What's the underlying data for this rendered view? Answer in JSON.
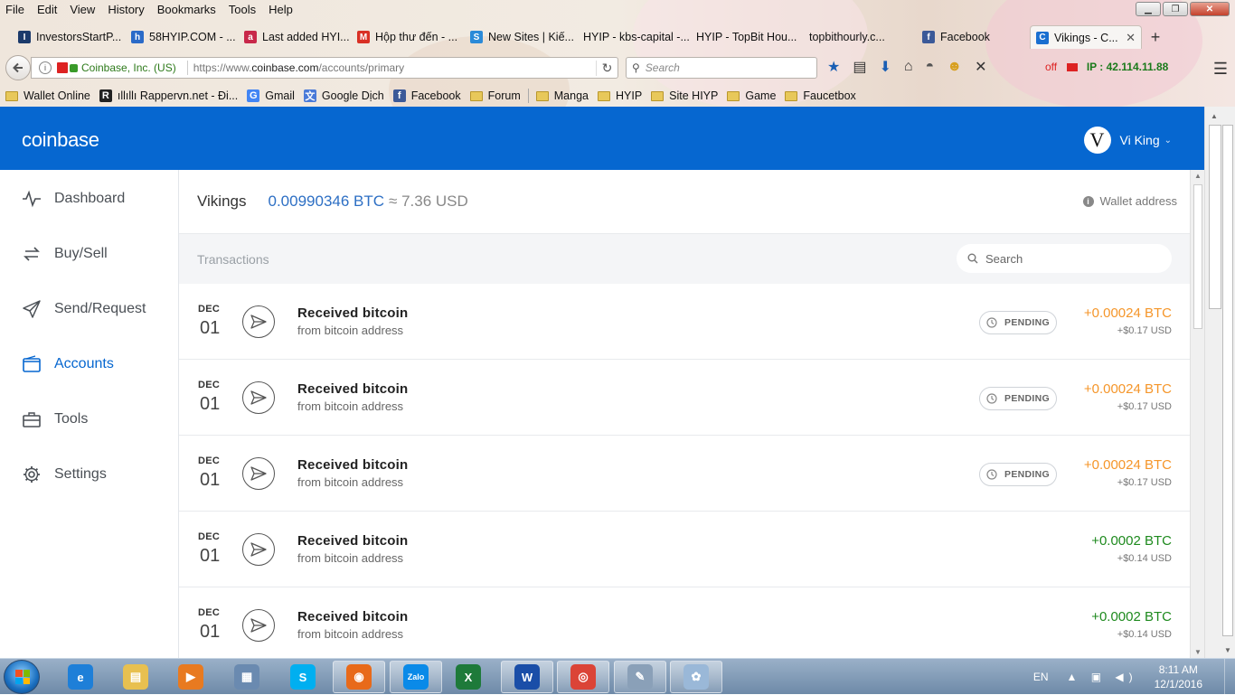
{
  "browser": {
    "menu": [
      "File",
      "Edit",
      "View",
      "History",
      "Bookmarks",
      "Tools",
      "Help"
    ],
    "tabs": [
      {
        "label": "InvestorsStartP...",
        "icon": "investorsstart-favicon",
        "color": "#1b3a6b",
        "glyph": "I"
      },
      {
        "label": "58HYIP.COM - ...",
        "icon": "hyip58-favicon",
        "color": "#2a6ac8",
        "glyph": "h"
      },
      {
        "label": "Last added HYI...",
        "icon": "lastadded-favicon",
        "color": "#c8284a",
        "glyph": "a"
      },
      {
        "label": "Hộp thư đến - ...",
        "icon": "gmail-favicon",
        "color": "#d93025",
        "glyph": "M"
      },
      {
        "label": "New Sites | Kiế...",
        "icon": "newsites-favicon",
        "color": "#2a8ad8",
        "glyph": "S"
      },
      {
        "label": "HYIP - kbs-capital -...",
        "icon": "none",
        "color": "transparent",
        "glyph": ""
      },
      {
        "label": "HYIP - TopBit Hou...",
        "icon": "none",
        "color": "transparent",
        "glyph": ""
      },
      {
        "label": "topbithourly.c...",
        "icon": "none",
        "color": "transparent",
        "glyph": ""
      },
      {
        "label": "Facebook",
        "icon": "facebook-favicon",
        "color": "#3b5998",
        "glyph": "f"
      },
      {
        "label": "Vikings - C...",
        "icon": "coinbase-favicon",
        "color": "#1a6fd0",
        "glyph": "C",
        "active": true
      }
    ],
    "url_identity": "Coinbase, Inc. (US)",
    "url_prefix": "https://www.",
    "url_domain": "coinbase.com",
    "url_path": "/accounts/primary",
    "search_placeholder": "Search",
    "ip_label": "IP : 42.114.11.88",
    "ip_status": "off",
    "bookmarks": [
      {
        "label": "Wallet Online",
        "type": "folder"
      },
      {
        "label": "ıllıllı Rappervn.net - Đi...",
        "type": "site",
        "color": "#222",
        "glyph": "R"
      },
      {
        "label": "Gmail",
        "type": "site",
        "color": "#4285f4",
        "glyph": "G"
      },
      {
        "label": "Google Dịch",
        "type": "site",
        "color": "#4a7ad8",
        "glyph": "文"
      },
      {
        "label": "Facebook",
        "type": "site",
        "color": "#3b5998",
        "glyph": "f"
      },
      {
        "label": "Forum",
        "type": "folder"
      },
      {
        "label": "Manga",
        "type": "folder",
        "sep_before": true
      },
      {
        "label": "HYIP",
        "type": "folder"
      },
      {
        "label": "Site HIYP",
        "type": "folder"
      },
      {
        "label": "Game",
        "type": "folder"
      },
      {
        "label": "Faucetbox",
        "type": "folder"
      }
    ]
  },
  "app": {
    "logo": "coinbase",
    "user_initial": "V",
    "user_name": "Vi King",
    "nav": [
      {
        "label": "Dashboard",
        "icon": "pulse-icon"
      },
      {
        "label": "Buy/Sell",
        "icon": "exchange-icon"
      },
      {
        "label": "Send/Request",
        "icon": "paper-plane-icon"
      },
      {
        "label": "Accounts",
        "icon": "wallet-icon",
        "active": true
      },
      {
        "label": "Tools",
        "icon": "toolbox-icon"
      },
      {
        "label": "Settings",
        "icon": "gear-icon"
      }
    ],
    "account": {
      "name": "Vikings",
      "btc_balance": "0.00990346 BTC",
      "usd_balance": "≈ 7.36 USD",
      "wallet_address_label": "Wallet address"
    },
    "transactions_label": "Transactions",
    "search_placeholder": "Search",
    "transactions": [
      {
        "month": "DEC",
        "day": "01",
        "title": "Received bitcoin",
        "subtitle": "from bitcoin address",
        "status": "PENDING",
        "amount": "+0.00024 BTC",
        "usd": "+$0.17 USD",
        "color": "orange"
      },
      {
        "month": "DEC",
        "day": "01",
        "title": "Received bitcoin",
        "subtitle": "from bitcoin address",
        "status": "PENDING",
        "amount": "+0.00024 BTC",
        "usd": "+$0.17 USD",
        "color": "orange"
      },
      {
        "month": "DEC",
        "day": "01",
        "title": "Received bitcoin",
        "subtitle": "from bitcoin address",
        "status": "PENDING",
        "amount": "+0.00024 BTC",
        "usd": "+$0.17 USD",
        "color": "orange"
      },
      {
        "month": "DEC",
        "day": "01",
        "title": "Received bitcoin",
        "subtitle": "from bitcoin address",
        "status": "",
        "amount": "+0.0002 BTC",
        "usd": "+$0.14 USD",
        "color": "green"
      },
      {
        "month": "DEC",
        "day": "01",
        "title": "Received bitcoin",
        "subtitle": "from bitcoin address",
        "status": "",
        "amount": "+0.0002 BTC",
        "usd": "+$0.14 USD",
        "color": "green"
      }
    ]
  },
  "taskbar": {
    "apps": [
      {
        "name": "ie",
        "color": "#1e7fd8",
        "glyph": "e"
      },
      {
        "name": "explorer",
        "color": "#e8c050",
        "glyph": "▤"
      },
      {
        "name": "media-player",
        "color": "#e87a20",
        "glyph": "▶"
      },
      {
        "name": "calculator",
        "color": "#6a8ab0",
        "glyph": "▦"
      },
      {
        "name": "skype",
        "color": "#00aff0",
        "glyph": "S"
      },
      {
        "name": "firefox",
        "color": "#e86a1a",
        "glyph": "◉",
        "open": true
      },
      {
        "name": "zalo",
        "color": "#0a8ae8",
        "glyph": "Zalo",
        "open": true
      },
      {
        "name": "excel",
        "color": "#1e7a3a",
        "glyph": "X"
      },
      {
        "name": "word",
        "color": "#1a4ea8",
        "glyph": "W",
        "open": true
      },
      {
        "name": "chrome",
        "color": "#db4437",
        "glyph": "◎",
        "open": true
      },
      {
        "name": "tool",
        "color": "#8aa0b8",
        "glyph": "✎",
        "open": true
      },
      {
        "name": "paint",
        "color": "#9ab8d8",
        "glyph": "✿",
        "open": true
      }
    ],
    "lang": "EN",
    "time": "8:11 AM",
    "date": "12/1/2016"
  }
}
